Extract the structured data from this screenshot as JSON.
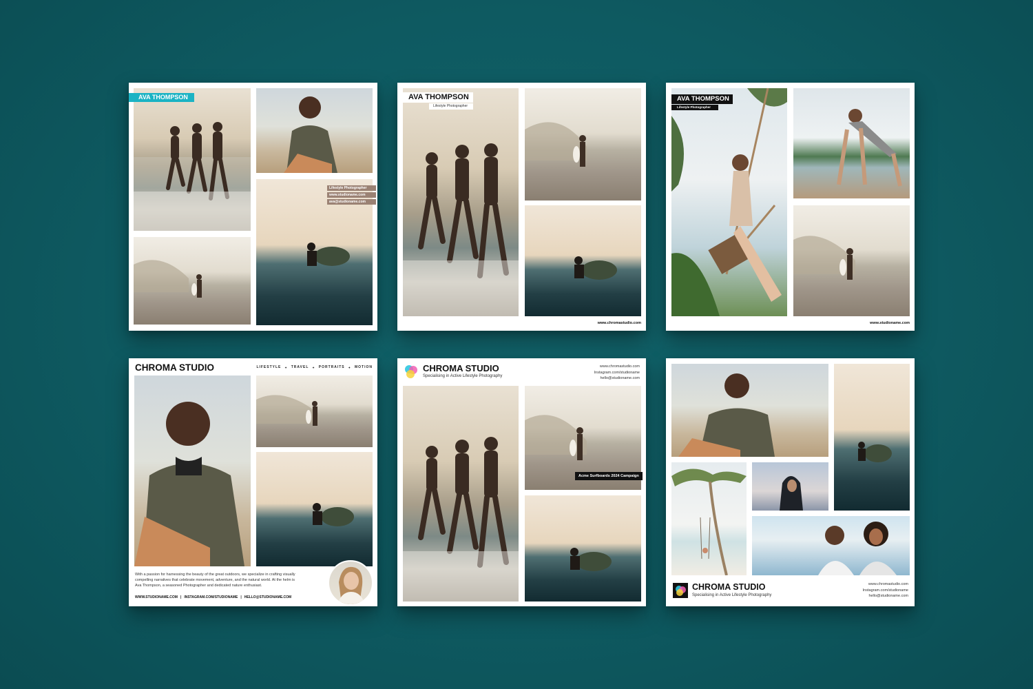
{
  "cards": {
    "c1": {
      "name_tag": "AVA THOMPSON",
      "info": [
        "Lifestyle Photographer",
        "www.studioname.com",
        "ava@studioname.com"
      ],
      "colors": {
        "accent": "#1bb3c4",
        "info_bg": "#9b8274"
      }
    },
    "c2": {
      "name_tag": "AVA THOMPSON",
      "subtitle": "Lifestyle Photographer",
      "footer_url": "www.chromastudio.com"
    },
    "c3": {
      "name_tag": "AVA THOMPSON",
      "subtitle": "Lifestyle Photographer",
      "footer_url": "www.studioname.com"
    },
    "c4": {
      "brand": "CHROMA STUDIO",
      "nav": [
        "LIFESTYLE",
        "TRAVEL",
        "PORTRAITS",
        "MOTION"
      ],
      "bio_lines": [
        "With a passion for harnessing the beauty of the great outdoors, we specialize in crafting visually",
        "compelling narratives that celebrate movement, adventure, and the natural world.  At the helm is",
        "Ava Thompson, a seasoned Photographer and dedicated nature enthusiast."
      ],
      "footer_links": [
        "WWW.STUDIONAME.COM",
        "INSTAGRAM.COM/STUDIONAME",
        "HELLO@STUDIONAME.COM"
      ]
    },
    "c5": {
      "brand": "CHROMA STUDIO",
      "tagline": "Specialising in Active Lifestyle Photography",
      "contact": [
        "www.chromastudio.com",
        "Instagram.com/studioname",
        "hello@studioname.com"
      ],
      "campaign_label": "Acme Surfboards 2024 Campaign"
    },
    "c6": {
      "brand": "CHROMA STUDIO",
      "tagline": "Specialising in Active Lifestyle Photography",
      "contact": [
        "www.chromastudio.com",
        "Instagram.com/studioname",
        "hello@studioname.com"
      ]
    }
  },
  "logo_colors": [
    "#2fc6e0",
    "#f25fb3",
    "#f7d23a",
    "#8a6cf0"
  ],
  "icons": [
    "chroma-logo-icon"
  ],
  "background_color": "#0e5a61"
}
